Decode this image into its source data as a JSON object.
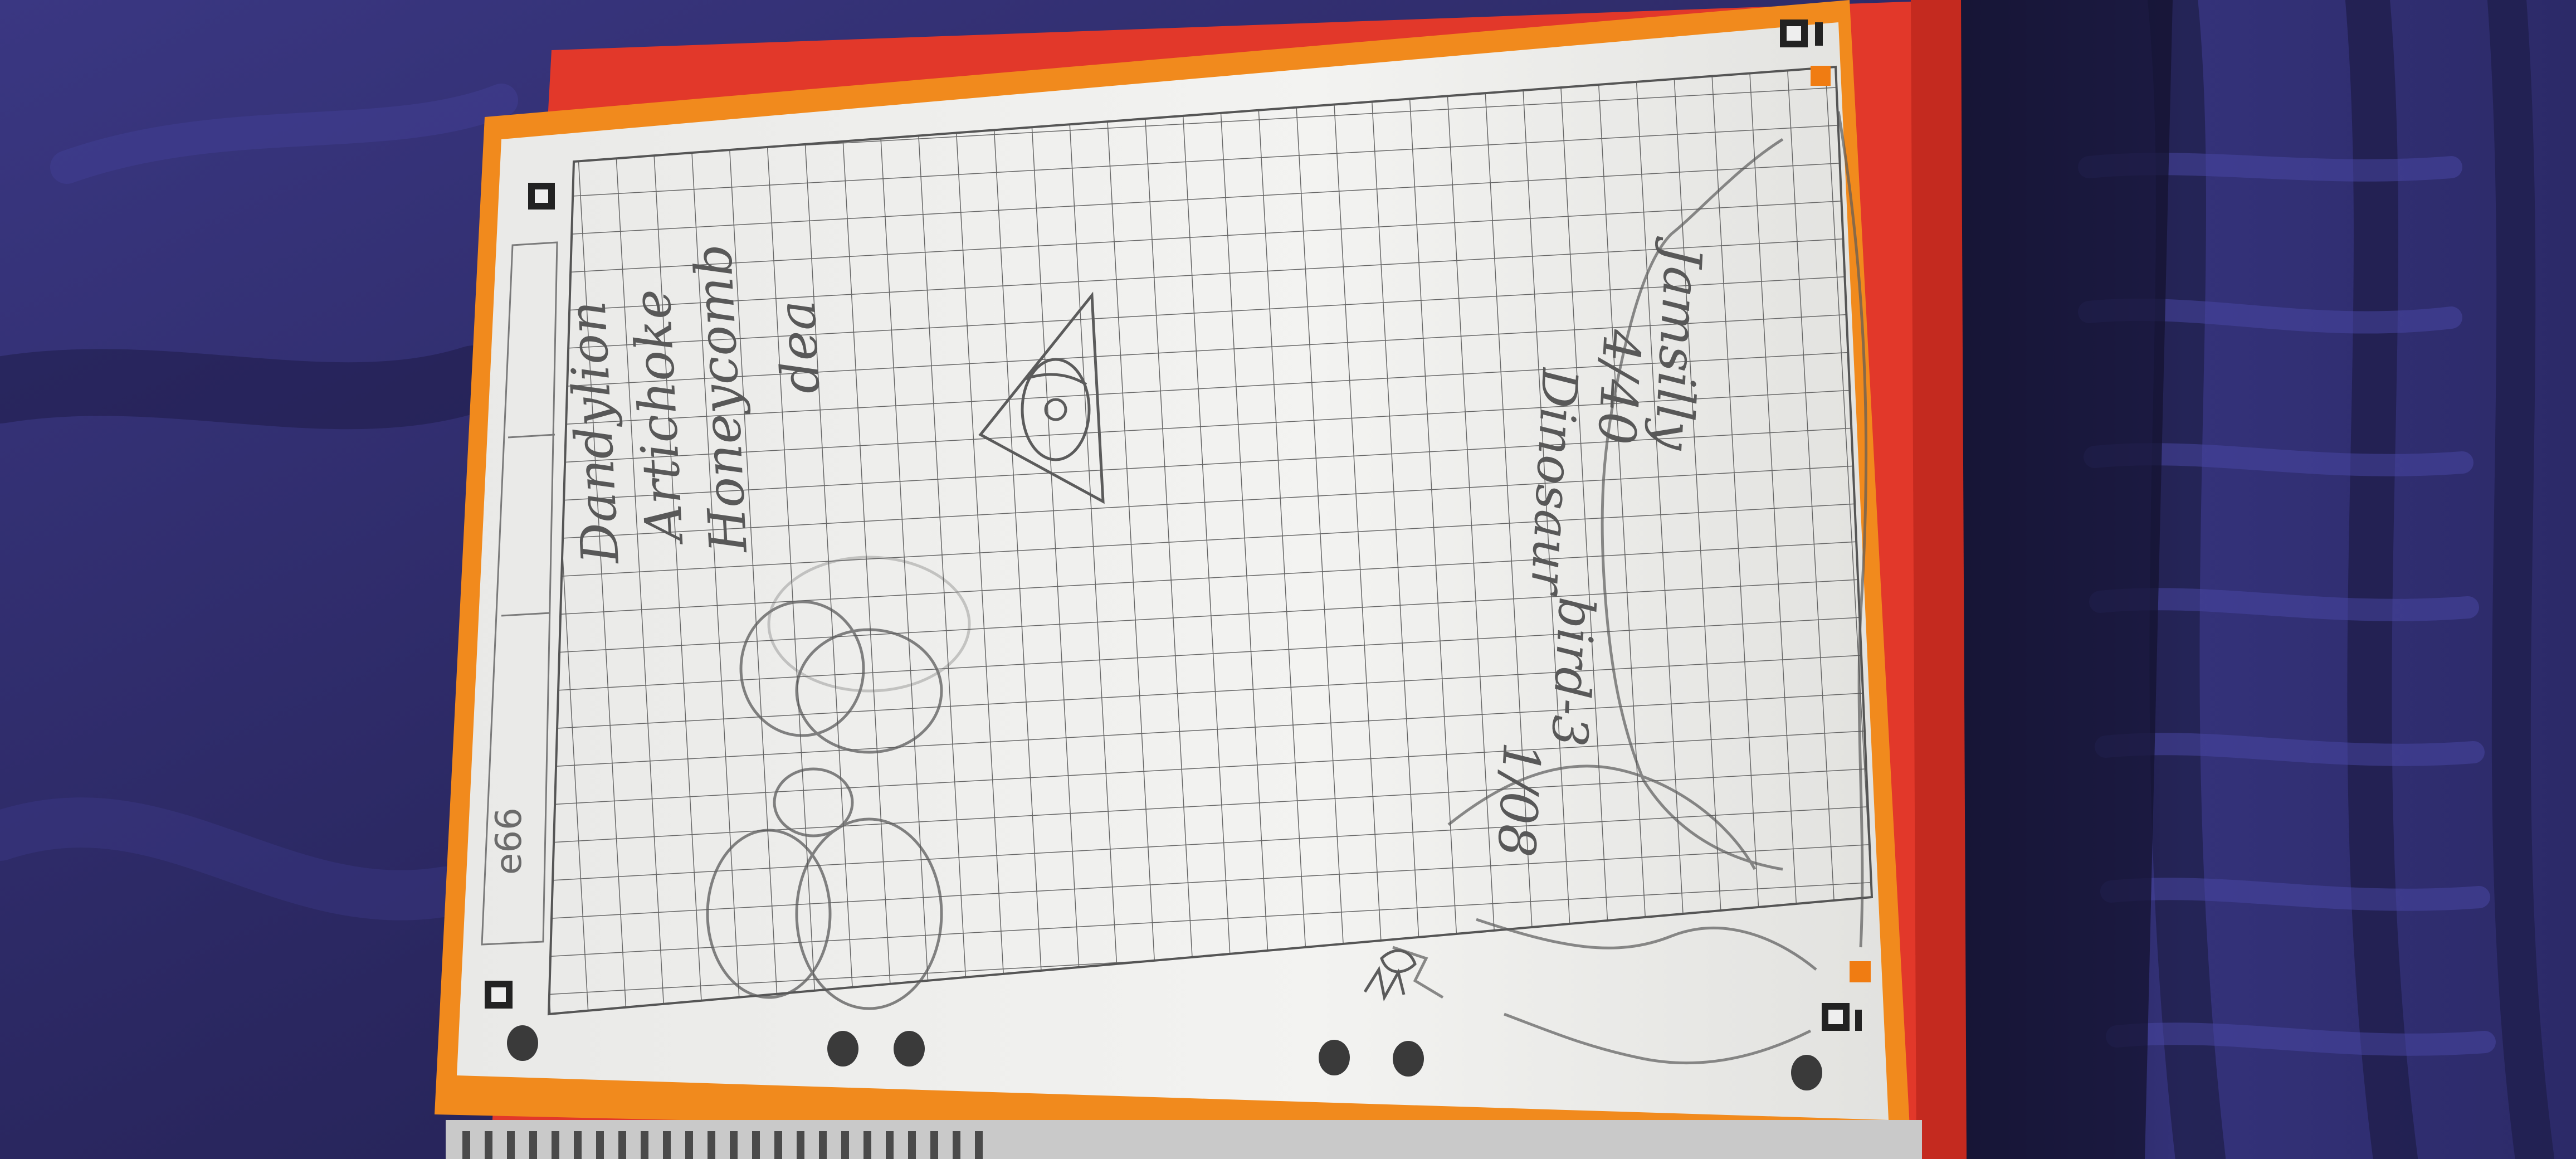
{
  "photo": {
    "subject": "spiral notebook with pencil sketches on grid paper",
    "colors": {
      "fabric": "#2f2c6a",
      "notebook_cover": "#e53b2a",
      "page_border": "#f08a1c",
      "paper": "#f1f1ef",
      "grid_line": "#6a6a6a",
      "pencil": "#555555"
    }
  },
  "notebook": {
    "page_label": "e66",
    "handwriting": [
      "Dandylion",
      "Artichoke",
      "Honeycomb",
      "dea",
      "Jamsilly",
      "4/40",
      "Dinosaur",
      "bird-3",
      "1/08"
    ]
  }
}
